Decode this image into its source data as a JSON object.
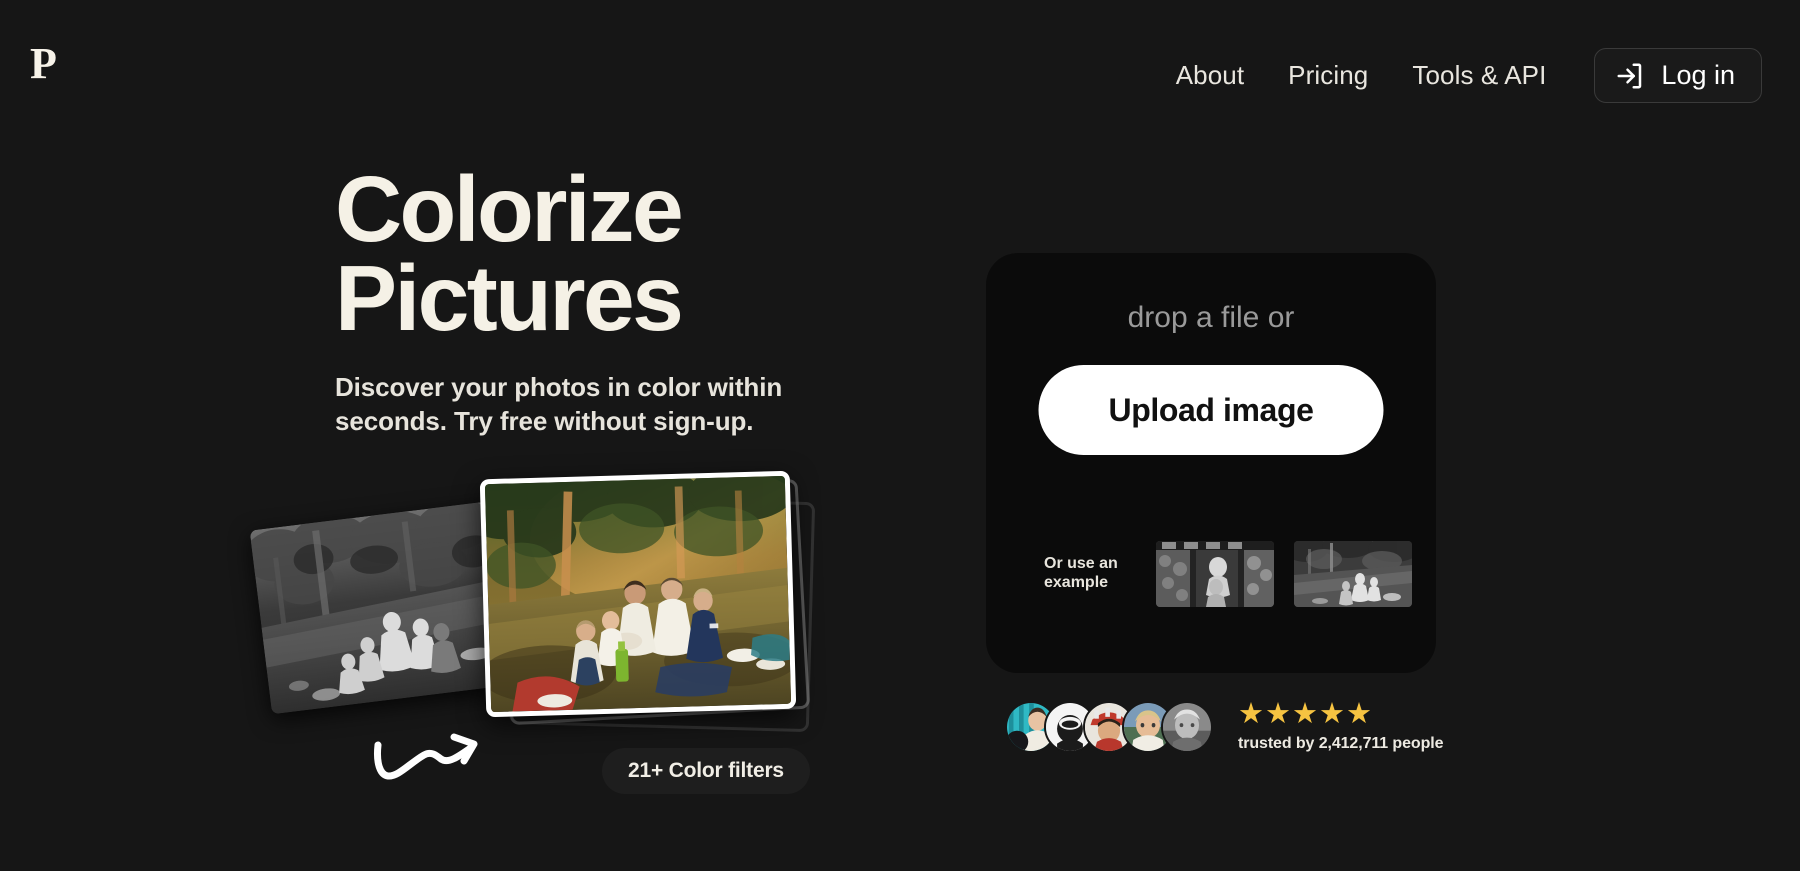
{
  "brand": {
    "logo_text": "P"
  },
  "nav": {
    "links": [
      {
        "label": "About"
      },
      {
        "label": "Pricing"
      },
      {
        "label": "Tools & API"
      }
    ],
    "login": {
      "label": "Log in",
      "icon": "login-arrow-icon"
    }
  },
  "hero": {
    "headline_line1": "Colorize",
    "headline_line2": "Pictures",
    "subhead": "Discover your photos in color within seconds. Try free without sign-up.",
    "filters_badge": "21+ Color filters",
    "arrow_icon": "curved-arrow-icon",
    "before_photo_alt": "black and white family picnic photo",
    "after_photo_alt": "colorized family picnic photo"
  },
  "uploader": {
    "drop_text": "drop a file or",
    "upload_button": "Upload image",
    "example_label": "Or use an example",
    "examples": [
      {
        "name": "example-thumb-1",
        "alt": "vintage portrait in doorway"
      },
      {
        "name": "example-thumb-2",
        "alt": "family picnic in forest"
      }
    ]
  },
  "social_proof": {
    "stars": "★★★★★",
    "star_count": 5,
    "trust_text": "trusted by 2,412,711 people",
    "people_count": "2,412,711",
    "avatars": [
      {
        "name": "avatar-1"
      },
      {
        "name": "avatar-2"
      },
      {
        "name": "avatar-3"
      },
      {
        "name": "avatar-4"
      },
      {
        "name": "avatar-5"
      }
    ]
  },
  "theme": {
    "page_bg": "#161616",
    "panel_bg": "#0B0B0B",
    "cream": "#F5F1E6",
    "muted": "#9A9A9A",
    "star_gold": "#F6C341",
    "button_bg": "#FFFFFF"
  }
}
